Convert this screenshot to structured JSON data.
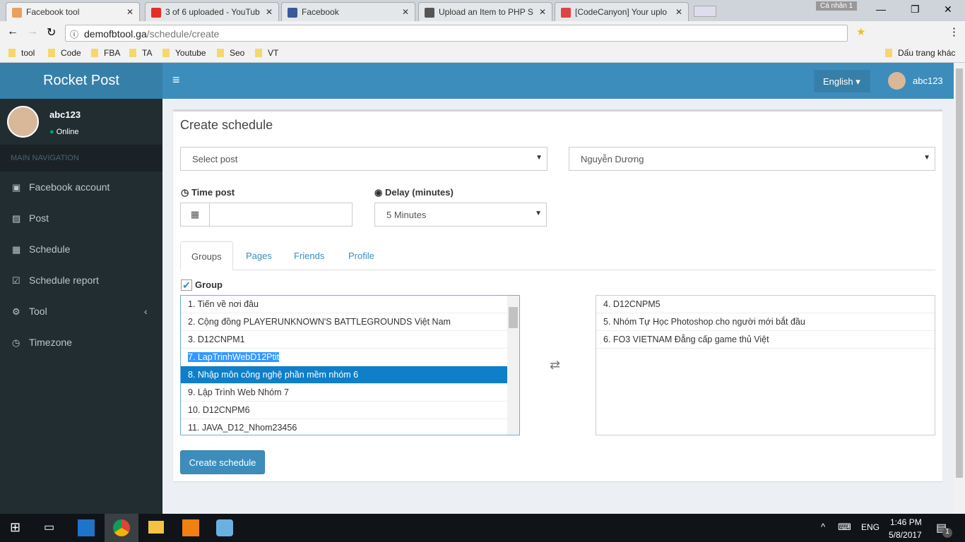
{
  "browser": {
    "tabs": [
      {
        "title": "Facebook tool"
      },
      {
        "title": "3 of 6 uploaded - YouTub"
      },
      {
        "title": "Facebook"
      },
      {
        "title": "Upload an Item to PHP S"
      },
      {
        "title": "[CodeCanyon] Your uplo"
      }
    ],
    "profile": "Cá nhân 1",
    "url_host": "demofbtool.ga",
    "url_path": "/schedule/create",
    "bookmarks": [
      "tool",
      "Code",
      "FBA",
      "TA",
      "Youtube",
      "Seo",
      "VT"
    ],
    "other_bookmarks": "Dấu trang khác"
  },
  "app": {
    "brand": "Rocket Post",
    "language": "English",
    "username": "abc123",
    "status": "Online",
    "nav_header": "MAIN NAVIGATION",
    "nav": [
      {
        "label": "Facebook account",
        "icon": "facebook-icon"
      },
      {
        "label": "Post",
        "icon": "image-icon"
      },
      {
        "label": "Schedule",
        "icon": "calendar-icon"
      },
      {
        "label": "Schedule report",
        "icon": "calendar-check-icon"
      },
      {
        "label": "Tool",
        "icon": "cogs-icon"
      },
      {
        "label": "Timezone",
        "icon": "clock-icon"
      }
    ]
  },
  "form": {
    "title": "Create schedule",
    "post_select": "Select post",
    "account_select": "Nguyễn Dương",
    "time_label": "Time post",
    "time_value": "",
    "delay_label": "Delay (minutes)",
    "delay_value": "5 Minutes",
    "tabs": [
      "Groups",
      "Pages",
      "Friends",
      "Profile"
    ],
    "group_checkbox": "Group",
    "group_checked": true,
    "available": [
      "1. Tiến về nơi đâu",
      "2. Cộng đồng PLAYERUNKNOWN'S BATTLEGROUNDS Việt Nam",
      "3. D12CNPM1",
      "7. LapTrinhWebD12Ptit",
      "8. Nhập môn công nghệ phần mềm nhóm 6",
      "9. Lập Trình Web Nhóm 7",
      "10. D12CNPM6",
      "11. JAVA_D12_Nhom23456"
    ],
    "selected": [
      "4. D12CNPM5",
      "5. Nhóm Tự Học Photoshop cho người mới bắt đầu",
      "6. FO3 VIETNAM Đẳng cấp game thủ Việt"
    ],
    "submit": "Create schedule"
  },
  "taskbar": {
    "lang": "ENG",
    "time": "1:46 PM",
    "date": "5/8/2017",
    "notifications": "1"
  }
}
